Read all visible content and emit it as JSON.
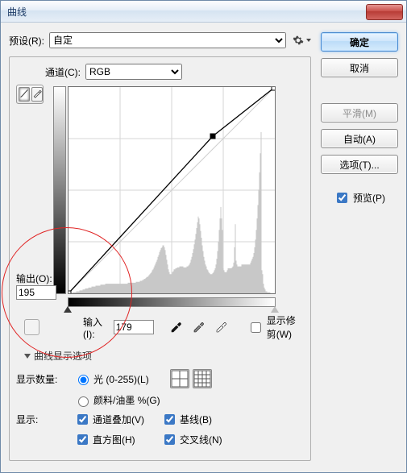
{
  "title": "曲线",
  "preset": {
    "label": "预设(R):",
    "value": "自定"
  },
  "channel": {
    "label": "通道(C):",
    "value": "RGB"
  },
  "output": {
    "label": "输出(O):",
    "value": "195"
  },
  "input": {
    "label": "输入(I):",
    "value": "179"
  },
  "show_clip": "显示修剪(W)",
  "disclosure": "曲线显示选项",
  "amount": {
    "label": "显示数量:",
    "light": "光 (0-255)(L)",
    "ink": "颜料/油墨 %(G)"
  },
  "show": {
    "label": "显示:",
    "overlay": "通道叠加(V)",
    "baseline": "基线(B)",
    "hist": "直方图(H)",
    "cross": "交叉线(N)"
  },
  "buttons": {
    "ok": "确定",
    "cancel": "取消",
    "smooth": "平滑(M)",
    "auto": "自动(A)",
    "options": "选项(T)..."
  },
  "preview": "预览(P)",
  "chart_data": {
    "type": "line",
    "title": "",
    "xlabel": "输入",
    "ylabel": "输出",
    "xlim": [
      0,
      255
    ],
    "ylim": [
      0,
      255
    ],
    "curve_points": [
      {
        "x": 0,
        "y": 0
      },
      {
        "x": 179,
        "y": 195
      },
      {
        "x": 255,
        "y": 255
      }
    ],
    "histogram_bins": [
      0,
      0,
      0,
      0,
      0,
      1,
      1,
      1,
      1,
      1,
      2,
      2,
      2,
      2,
      3,
      3,
      3,
      3,
      4,
      4,
      4,
      5,
      5,
      5,
      5,
      6,
      6,
      6,
      6,
      7,
      7,
      7,
      7,
      7,
      8,
      8,
      8,
      8,
      8,
      8,
      9,
      9,
      9,
      9,
      9,
      9,
      10,
      10,
      10,
      10,
      10,
      10,
      10,
      10,
      10,
      10,
      10,
      10,
      10,
      10,
      10,
      10,
      10,
      10,
      10,
      10,
      10,
      10,
      10,
      10,
      10,
      10,
      10,
      10,
      11,
      11,
      11,
      11,
      11,
      11,
      11,
      11,
      11,
      11,
      12,
      12,
      12,
      12,
      12,
      13,
      13,
      13,
      14,
      14,
      15,
      15,
      16,
      17,
      17,
      18,
      19,
      20,
      21,
      22,
      24,
      25,
      27,
      29,
      31,
      33,
      35,
      38,
      40,
      43,
      45,
      47,
      48,
      50,
      50,
      48,
      45,
      40,
      35,
      30,
      25,
      22,
      20,
      20,
      20,
      22,
      23,
      25,
      25,
      26,
      26,
      27,
      27,
      27,
      28,
      28,
      28,
      28,
      28,
      27,
      27,
      27,
      27,
      28,
      28,
      29,
      30,
      32,
      35,
      38,
      42,
      46,
      51,
      56,
      62,
      68,
      74,
      80,
      78,
      72,
      65,
      58,
      50,
      44,
      38,
      34,
      30,
      28,
      25,
      24,
      22,
      21,
      20,
      20,
      20,
      21,
      22,
      24,
      26,
      30,
      36,
      44,
      54,
      66,
      78,
      90,
      78,
      66,
      26,
      24,
      22,
      22,
      22,
      24,
      26,
      26,
      26,
      26,
      26,
      27,
      28,
      32,
      48,
      72,
      34,
      30,
      28,
      28,
      28,
      28,
      28,
      30,
      30,
      30,
      30,
      30,
      30,
      30,
      30,
      30,
      30,
      30,
      32,
      34,
      36,
      38,
      42,
      48,
      56,
      66,
      78,
      92,
      108,
      126,
      146,
      168,
      24,
      20,
      10,
      6,
      4,
      2,
      2,
      1,
      1,
      1,
      1,
      0,
      0,
      0,
      0,
      0
    ]
  },
  "icons": {
    "gear": "gear-icon",
    "curve_tool": "curve-tool-icon",
    "pencil_tool": "pencil-tool-icon",
    "hand": "hand-icon",
    "eyedropper_b": "eyedropper-black-icon",
    "eyedropper_g": "eyedropper-gray-icon",
    "eyedropper_w": "eyedropper-white-icon",
    "grid4": "grid-4-icon",
    "grid10": "grid-10-icon"
  }
}
